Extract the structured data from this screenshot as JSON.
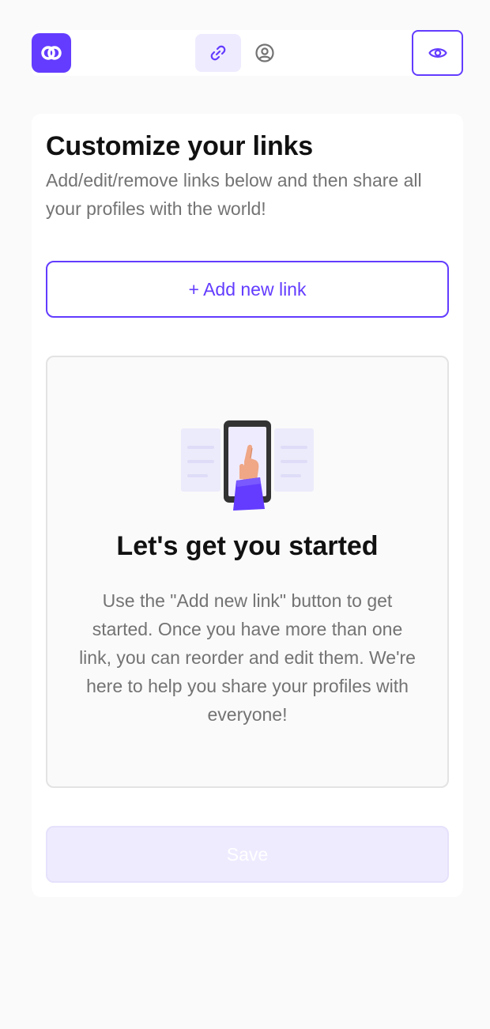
{
  "header": {
    "logo_icon": "link-logo-icon",
    "tabs": [
      {
        "icon": "link-icon",
        "active": true
      },
      {
        "icon": "profile-circle-icon",
        "active": false
      }
    ],
    "preview_icon": "eye-icon"
  },
  "main": {
    "title": "Customize your links",
    "subtitle": "Add/edit/remove links below and then share all your profiles with the world!",
    "add_link_label": "+ Add new link",
    "empty_state": {
      "illustration": "phone-hand-illustration",
      "title": "Let's get you started",
      "text": "Use the \"Add new link\" button to get started. Once you have more than one link, you can reorder and edit them. We're here to help you share your profiles with everyone!"
    },
    "save_label": "Save"
  },
  "colors": {
    "accent": "#633cff",
    "accent_light": "#efebff",
    "text_dark": "#111111",
    "text_muted": "#737373",
    "background": "#fafafa"
  }
}
